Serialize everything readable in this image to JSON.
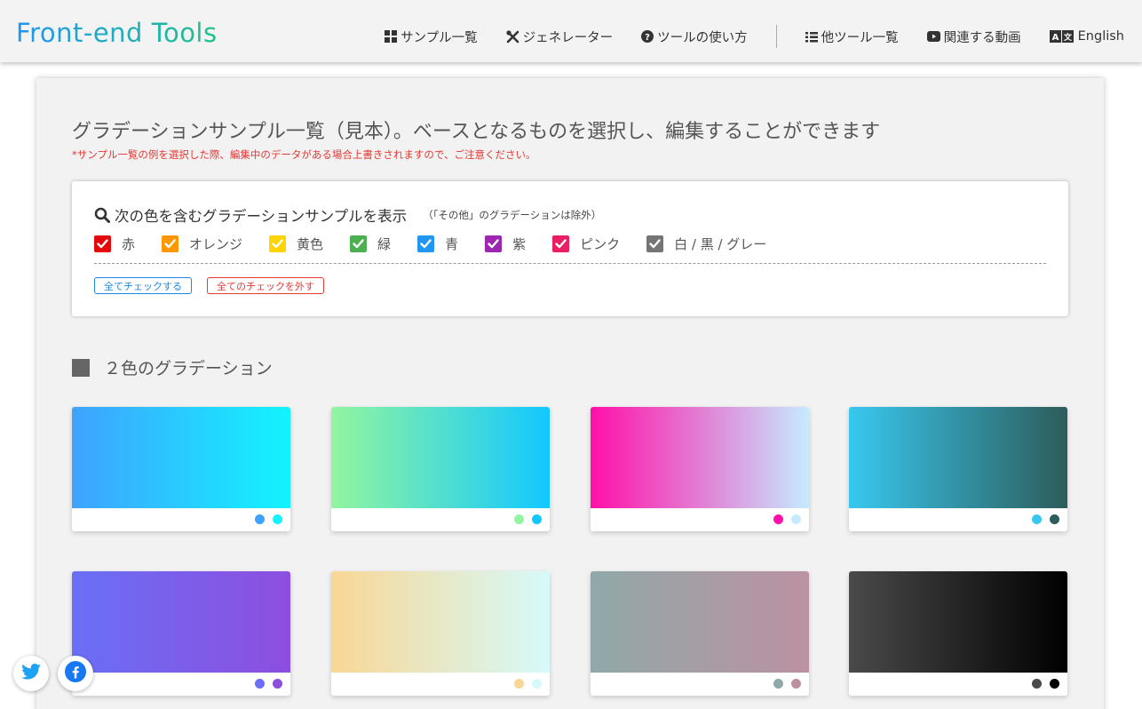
{
  "header": {
    "logo": "Front-end Tools",
    "nav": [
      {
        "label": "サンプル一覧",
        "icon": "grid-icon"
      },
      {
        "label": "ジェネレーター",
        "icon": "tools-icon"
      },
      {
        "label": "ツールの使い方",
        "icon": "question-circle-icon"
      },
      {
        "label": "他ツール一覧",
        "icon": "list-icon"
      },
      {
        "label": "関連する動画",
        "icon": "youtube-icon"
      },
      {
        "label": "English",
        "icon": "translate-icon"
      }
    ]
  },
  "main": {
    "title": "グラデーションサンプル一覧（見本）。ベースとなるものを選択し、編集することができます",
    "notice": "*サンプル一覧の例を選択した際、編集中のデータがある場合上書きされますので、ご注意ください。"
  },
  "filter": {
    "title": "次の色を含むグラデーションサンプルを表示",
    "note": "（「その他」のグラデーションは除外）",
    "options": [
      {
        "label": "赤",
        "color": "#e4080a",
        "checked": true
      },
      {
        "label": "オレンジ",
        "color": "#ff9800",
        "checked": true
      },
      {
        "label": "黄色",
        "color": "#ffd400",
        "checked": true
      },
      {
        "label": "緑",
        "color": "#4caf50",
        "checked": true
      },
      {
        "label": "青",
        "color": "#2196f3",
        "checked": true
      },
      {
        "label": "紫",
        "color": "#9c27b0",
        "checked": true
      },
      {
        "label": "ピンク",
        "color": "#e91e63",
        "checked": true
      },
      {
        "label": "白 / 黒 / グレー",
        "color": "#757575",
        "checked": true
      }
    ],
    "check_all": "全てチェックする",
    "uncheck_all": "全てのチェックを外す"
  },
  "section": {
    "title": "２色のグラデーション"
  },
  "samples": [
    {
      "from": "#3fa2ff",
      "to": "#12f4ff"
    },
    {
      "from": "#92f59f",
      "to": "#12c8ff"
    },
    {
      "from": "#ff10a8",
      "to": "#c6ebff"
    },
    {
      "from": "#38c8ef",
      "to": "#2d5c5b"
    },
    {
      "from": "#6a6ff6",
      "to": "#8d4ede"
    },
    {
      "from": "#f8d795",
      "to": "#d6fafb"
    },
    {
      "from": "#90a9a8",
      "to": "#bc91a2"
    },
    {
      "from": "#4a4a4a",
      "to": "#000000"
    }
  ],
  "social": [
    {
      "name": "twitter-icon",
      "color": "#1da1f2"
    },
    {
      "name": "facebook-icon",
      "color": "#1877f2"
    }
  ]
}
